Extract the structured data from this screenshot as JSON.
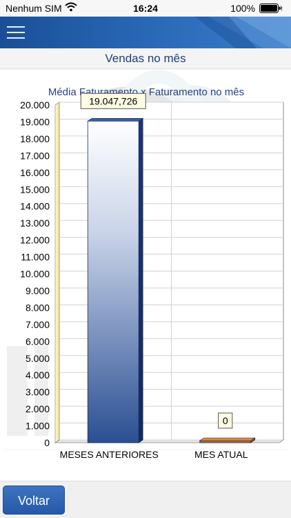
{
  "status_bar": {
    "carrier": "Nenhum SIM",
    "time": "16:24",
    "battery_percent": "100%"
  },
  "icons": {
    "menu": "hamburger-icon",
    "wifi": "wifi-icon",
    "battery": "battery-icon"
  },
  "colors": {
    "header": "#2a6ab9",
    "title": "#1f3f7a",
    "bar_blue": "#2a4f92",
    "bar_orange": "#c06a23",
    "axis_wall": "#f2e27a"
  },
  "page": {
    "title": "Vendas no mês"
  },
  "chart_data": {
    "type": "bar",
    "title": "Média Faturamento x Faturamento no mês",
    "categories": [
      "MESES ANTERIORES",
      "MES ATUAL"
    ],
    "values": [
      19047.726,
      0
    ],
    "data_labels": [
      "19.047,726",
      "0"
    ],
    "ylim": [
      0,
      20000
    ],
    "y_ticks": [
      0,
      1000,
      2000,
      3000,
      4000,
      5000,
      6000,
      7000,
      8000,
      9000,
      10000,
      11000,
      12000,
      13000,
      14000,
      15000,
      16000,
      17000,
      18000,
      19000,
      20000
    ],
    "y_tick_labels": [
      "0",
      "1.000",
      "2.000",
      "3.000",
      "4.000",
      "5.000",
      "6.000",
      "7.000",
      "8.000",
      "9.000",
      "10.000",
      "11.000",
      "12.000",
      "13.000",
      "14.000",
      "15.000",
      "16.000",
      "17.000",
      "18.000",
      "19.000",
      "20.000"
    ],
    "grid": true,
    "style": "3d"
  },
  "footer": {
    "back_label": "Voltar"
  }
}
